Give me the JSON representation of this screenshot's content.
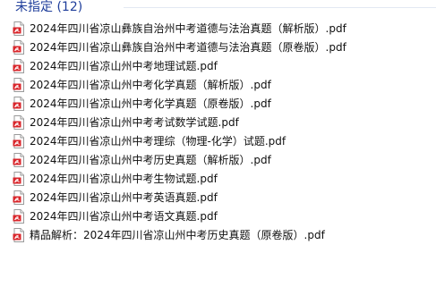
{
  "group": {
    "title": "未指定 (12)"
  },
  "files": [
    {
      "name": "2024年四川省凉山彝族自治州中考道德与法治真题（解析版）.pdf",
      "icon": "pdf-file-icon"
    },
    {
      "name": "2024年四川省凉山彝族自治州中考道德与法治真题（原卷版）.pdf",
      "icon": "pdf-file-icon"
    },
    {
      "name": "2024年四川省凉山州中考地理试题.pdf",
      "icon": "pdf-file-icon"
    },
    {
      "name": "2024年四川省凉山州中考化学真题（解析版）.pdf",
      "icon": "pdf-file-icon"
    },
    {
      "name": "2024年四川省凉山州中考化学真题（原卷版）.pdf",
      "icon": "pdf-file-icon"
    },
    {
      "name": "2024年四川省凉山州中考考试数学试题.pdf",
      "icon": "pdf-file-icon"
    },
    {
      "name": "2024年四川省凉山州中考理综（物理-化学）试题.pdf",
      "icon": "pdf-file-icon"
    },
    {
      "name": "2024年四川省凉山州中考历史真题（解析版）.pdf",
      "icon": "pdf-file-icon"
    },
    {
      "name": "2024年四川省凉山州中考生物试题.pdf",
      "icon": "pdf-file-icon"
    },
    {
      "name": "2024年四川省凉山州中考英语真题.pdf",
      "icon": "pdf-file-icon"
    },
    {
      "name": "2024年四川省凉山州中考语文真题.pdf",
      "icon": "pdf-file-icon"
    },
    {
      "name": "精品解析：2024年四川省凉山州中考历史真题（原卷版）.pdf",
      "icon": "pdf-file-icon"
    }
  ],
  "colors": {
    "group_title": "#1f3e9b",
    "separator": "#e2e8f3",
    "pdf_red": "#d9262b"
  }
}
